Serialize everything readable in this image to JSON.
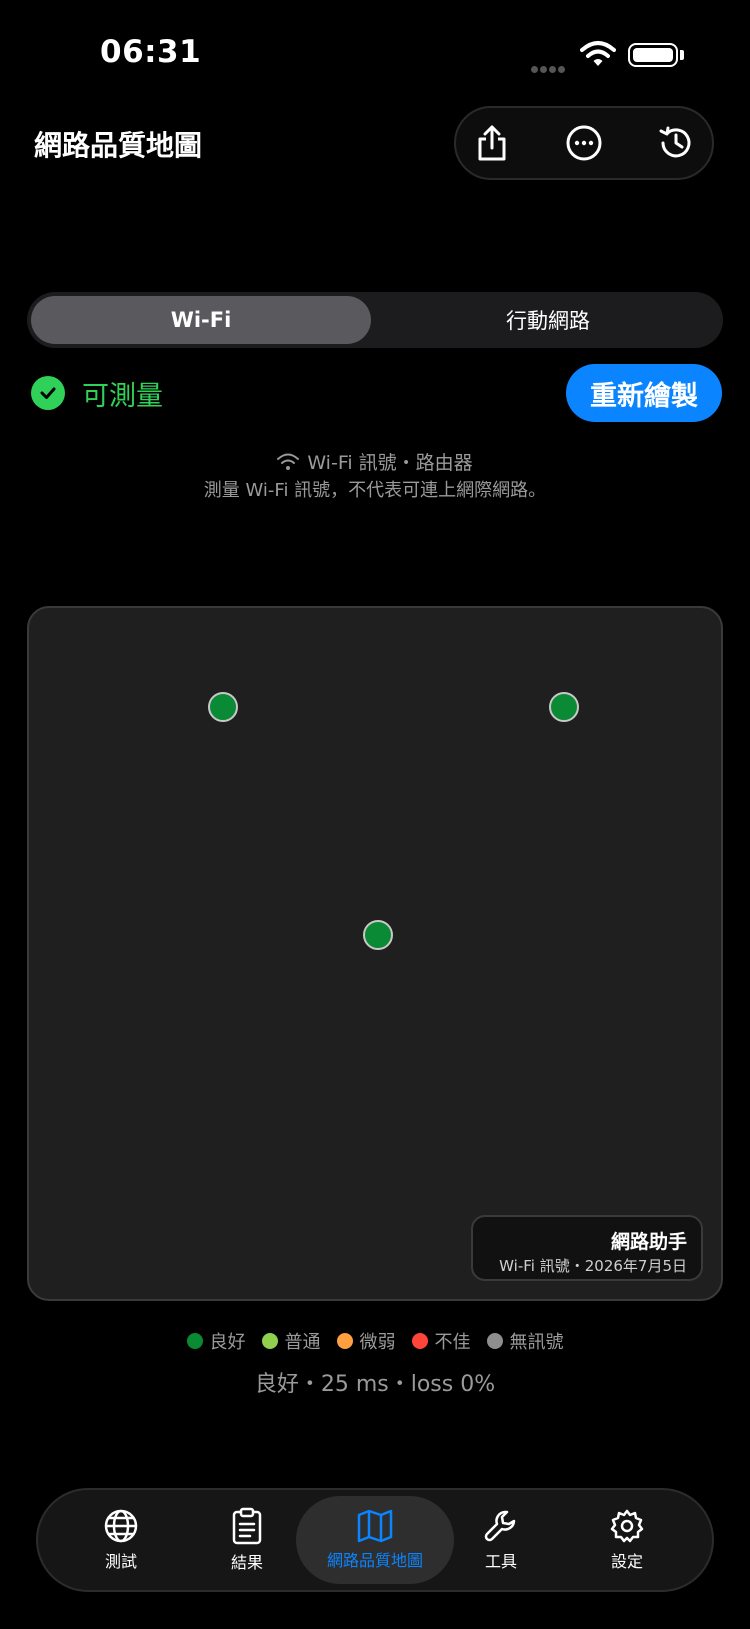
{
  "status_bar": {
    "time": "06:31"
  },
  "header": {
    "title": "網路品質地圖",
    "actions": [
      "share-icon",
      "ellipsis-circle-icon",
      "history-icon"
    ]
  },
  "segment": {
    "items": [
      {
        "label": "Wi-Fi",
        "selected": true
      },
      {
        "label": "行動網路",
        "selected": false
      }
    ]
  },
  "status": {
    "label": "可測量",
    "color": "#30d158"
  },
  "redraw_button": {
    "label": "重新繪製",
    "color": "#0a84ff"
  },
  "info": {
    "line1": "Wi-Fi 訊號・路由器",
    "line2": "測量 Wi-Fi 訊號，不代表可連上網際網路。"
  },
  "map": {
    "points": [
      {
        "quality": "良好",
        "color": "#0a8a35"
      },
      {
        "quality": "良好",
        "color": "#0a8a35"
      },
      {
        "quality": "良好",
        "color": "#0a8a35"
      }
    ],
    "watermark": {
      "title": "網路助手",
      "subtitle": "Wi-Fi 訊號・2026年7月5日"
    }
  },
  "legend": [
    {
      "label": "良好",
      "color": "#0a8a35"
    },
    {
      "label": "普通",
      "color": "#8fd14f"
    },
    {
      "label": "微弱",
      "color": "#ff9f40"
    },
    {
      "label": "不佳",
      "color": "#ff453a"
    },
    {
      "label": "無訊號",
      "color": "#8e8e8e"
    }
  ],
  "summary": "良好・25 ms・loss 0%",
  "tabs": [
    {
      "label": "測試",
      "icon": "globe-icon"
    },
    {
      "label": "結果",
      "icon": "clipboard-icon"
    },
    {
      "label": "網路品質地圖",
      "icon": "map-icon",
      "active": true
    },
    {
      "label": "工具",
      "icon": "wrench-icon"
    },
    {
      "label": "設定",
      "icon": "gear-icon"
    }
  ]
}
